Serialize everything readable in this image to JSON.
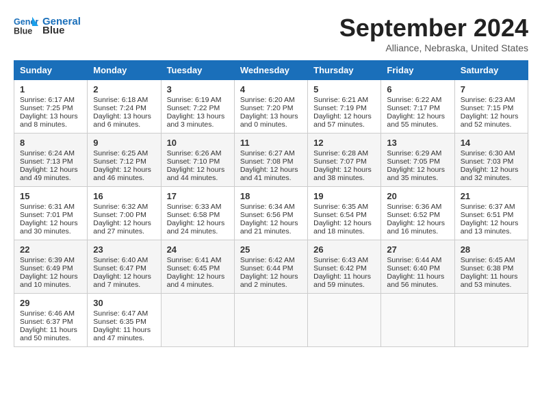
{
  "header": {
    "logo_line1": "General",
    "logo_line2": "Blue",
    "month": "September 2024",
    "location": "Alliance, Nebraska, United States"
  },
  "days_of_week": [
    "Sunday",
    "Monday",
    "Tuesday",
    "Wednesday",
    "Thursday",
    "Friday",
    "Saturday"
  ],
  "weeks": [
    [
      {
        "day": 1,
        "lines": [
          "Sunrise: 6:17 AM",
          "Sunset: 7:25 PM",
          "Daylight: 13 hours",
          "and 8 minutes."
        ]
      },
      {
        "day": 2,
        "lines": [
          "Sunrise: 6:18 AM",
          "Sunset: 7:24 PM",
          "Daylight: 13 hours",
          "and 6 minutes."
        ]
      },
      {
        "day": 3,
        "lines": [
          "Sunrise: 6:19 AM",
          "Sunset: 7:22 PM",
          "Daylight: 13 hours",
          "and 3 minutes."
        ]
      },
      {
        "day": 4,
        "lines": [
          "Sunrise: 6:20 AM",
          "Sunset: 7:20 PM",
          "Daylight: 13 hours",
          "and 0 minutes."
        ]
      },
      {
        "day": 5,
        "lines": [
          "Sunrise: 6:21 AM",
          "Sunset: 7:19 PM",
          "Daylight: 12 hours",
          "and 57 minutes."
        ]
      },
      {
        "day": 6,
        "lines": [
          "Sunrise: 6:22 AM",
          "Sunset: 7:17 PM",
          "Daylight: 12 hours",
          "and 55 minutes."
        ]
      },
      {
        "day": 7,
        "lines": [
          "Sunrise: 6:23 AM",
          "Sunset: 7:15 PM",
          "Daylight: 12 hours",
          "and 52 minutes."
        ]
      }
    ],
    [
      {
        "day": 8,
        "lines": [
          "Sunrise: 6:24 AM",
          "Sunset: 7:13 PM",
          "Daylight: 12 hours",
          "and 49 minutes."
        ]
      },
      {
        "day": 9,
        "lines": [
          "Sunrise: 6:25 AM",
          "Sunset: 7:12 PM",
          "Daylight: 12 hours",
          "and 46 minutes."
        ]
      },
      {
        "day": 10,
        "lines": [
          "Sunrise: 6:26 AM",
          "Sunset: 7:10 PM",
          "Daylight: 12 hours",
          "and 44 minutes."
        ]
      },
      {
        "day": 11,
        "lines": [
          "Sunrise: 6:27 AM",
          "Sunset: 7:08 PM",
          "Daylight: 12 hours",
          "and 41 minutes."
        ]
      },
      {
        "day": 12,
        "lines": [
          "Sunrise: 6:28 AM",
          "Sunset: 7:07 PM",
          "Daylight: 12 hours",
          "and 38 minutes."
        ]
      },
      {
        "day": 13,
        "lines": [
          "Sunrise: 6:29 AM",
          "Sunset: 7:05 PM",
          "Daylight: 12 hours",
          "and 35 minutes."
        ]
      },
      {
        "day": 14,
        "lines": [
          "Sunrise: 6:30 AM",
          "Sunset: 7:03 PM",
          "Daylight: 12 hours",
          "and 32 minutes."
        ]
      }
    ],
    [
      {
        "day": 15,
        "lines": [
          "Sunrise: 6:31 AM",
          "Sunset: 7:01 PM",
          "Daylight: 12 hours",
          "and 30 minutes."
        ]
      },
      {
        "day": 16,
        "lines": [
          "Sunrise: 6:32 AM",
          "Sunset: 7:00 PM",
          "Daylight: 12 hours",
          "and 27 minutes."
        ]
      },
      {
        "day": 17,
        "lines": [
          "Sunrise: 6:33 AM",
          "Sunset: 6:58 PM",
          "Daylight: 12 hours",
          "and 24 minutes."
        ]
      },
      {
        "day": 18,
        "lines": [
          "Sunrise: 6:34 AM",
          "Sunset: 6:56 PM",
          "Daylight: 12 hours",
          "and 21 minutes."
        ]
      },
      {
        "day": 19,
        "lines": [
          "Sunrise: 6:35 AM",
          "Sunset: 6:54 PM",
          "Daylight: 12 hours",
          "and 18 minutes."
        ]
      },
      {
        "day": 20,
        "lines": [
          "Sunrise: 6:36 AM",
          "Sunset: 6:52 PM",
          "Daylight: 12 hours",
          "and 16 minutes."
        ]
      },
      {
        "day": 21,
        "lines": [
          "Sunrise: 6:37 AM",
          "Sunset: 6:51 PM",
          "Daylight: 12 hours",
          "and 13 minutes."
        ]
      }
    ],
    [
      {
        "day": 22,
        "lines": [
          "Sunrise: 6:39 AM",
          "Sunset: 6:49 PM",
          "Daylight: 12 hours",
          "and 10 minutes."
        ]
      },
      {
        "day": 23,
        "lines": [
          "Sunrise: 6:40 AM",
          "Sunset: 6:47 PM",
          "Daylight: 12 hours",
          "and 7 minutes."
        ]
      },
      {
        "day": 24,
        "lines": [
          "Sunrise: 6:41 AM",
          "Sunset: 6:45 PM",
          "Daylight: 12 hours",
          "and 4 minutes."
        ]
      },
      {
        "day": 25,
        "lines": [
          "Sunrise: 6:42 AM",
          "Sunset: 6:44 PM",
          "Daylight: 12 hours",
          "and 2 minutes."
        ]
      },
      {
        "day": 26,
        "lines": [
          "Sunrise: 6:43 AM",
          "Sunset: 6:42 PM",
          "Daylight: 11 hours",
          "and 59 minutes."
        ]
      },
      {
        "day": 27,
        "lines": [
          "Sunrise: 6:44 AM",
          "Sunset: 6:40 PM",
          "Daylight: 11 hours",
          "and 56 minutes."
        ]
      },
      {
        "day": 28,
        "lines": [
          "Sunrise: 6:45 AM",
          "Sunset: 6:38 PM",
          "Daylight: 11 hours",
          "and 53 minutes."
        ]
      }
    ],
    [
      {
        "day": 29,
        "lines": [
          "Sunrise: 6:46 AM",
          "Sunset: 6:37 PM",
          "Daylight: 11 hours",
          "and 50 minutes."
        ]
      },
      {
        "day": 30,
        "lines": [
          "Sunrise: 6:47 AM",
          "Sunset: 6:35 PM",
          "Daylight: 11 hours",
          "and 47 minutes."
        ]
      },
      null,
      null,
      null,
      null,
      null
    ]
  ]
}
